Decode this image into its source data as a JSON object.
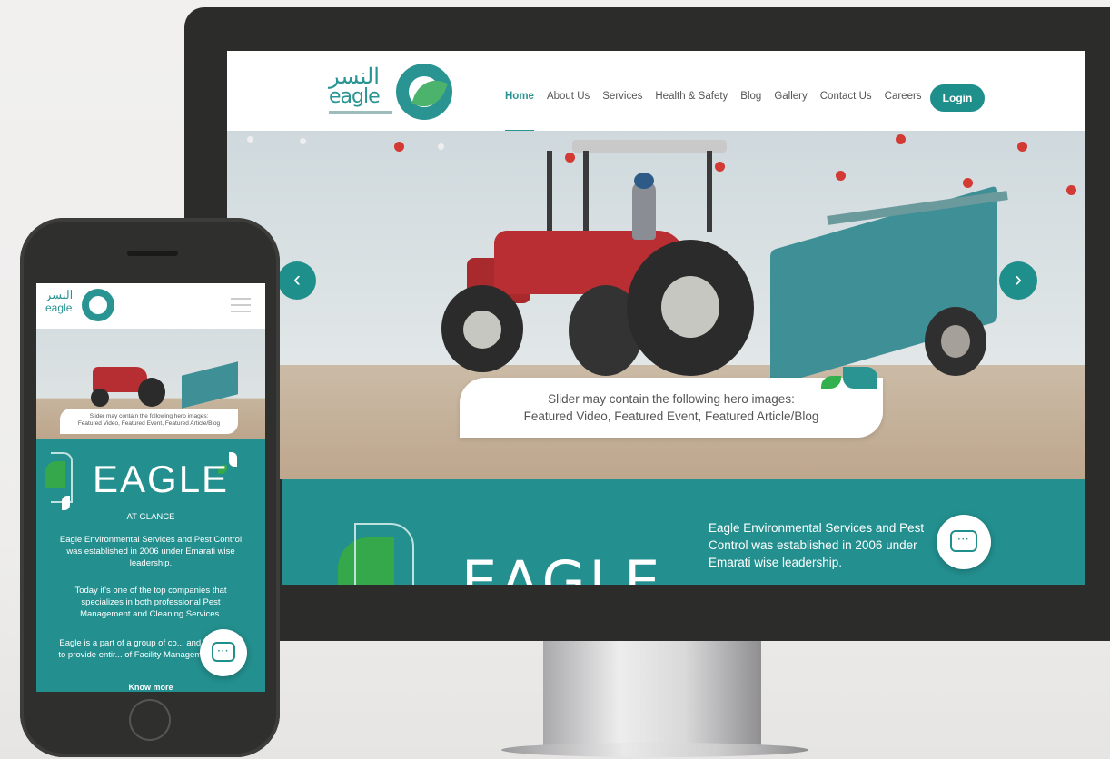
{
  "desktop": {
    "logo": {
      "arabic": "النسر",
      "english": "eagle"
    },
    "nav": [
      "Home",
      "About Us",
      "Services",
      "Health & Safety",
      "Blog",
      "Gallery",
      "Contact Us",
      "Careers"
    ],
    "login_label": "Login",
    "slider": {
      "prev_icon": "‹",
      "next_icon": "›",
      "caption_line1": "Slider may contain the following hero images:",
      "caption_line2": "Featured Video, Featured Event, Featured Article/Blog"
    },
    "glance": {
      "title": "EAGLE",
      "text": "Eagle Environmental Services and Pest Control was established in 2006 under Emarati wise leadership."
    },
    "chat_icon": "chat-icon"
  },
  "mobile": {
    "logo": {
      "arabic": "النسر",
      "english": "eagle"
    },
    "caption_line1": "Slider may contain the following hero images:",
    "caption_line2": "Featured Video, Featured Event, Featured Article/Blog",
    "glance_title": "EAGLE",
    "glance_subtitle": "AT GLANCE",
    "para1": "Eagle Environmental Services and Pest Control was established in 2006 under Emarati wise leadership.",
    "para2": "Today it's one of the top companies that specializes in both professional Pest Management and Cleaning Services.",
    "para3": "Eagle is a part of a group of co... and is capable to provide entir... of Facility Management Servi...",
    "know_more": "Know more"
  },
  "colors": {
    "brand_teal": "#23908f",
    "accent_green": "#35a84b",
    "hero_red": "#b92e32"
  }
}
